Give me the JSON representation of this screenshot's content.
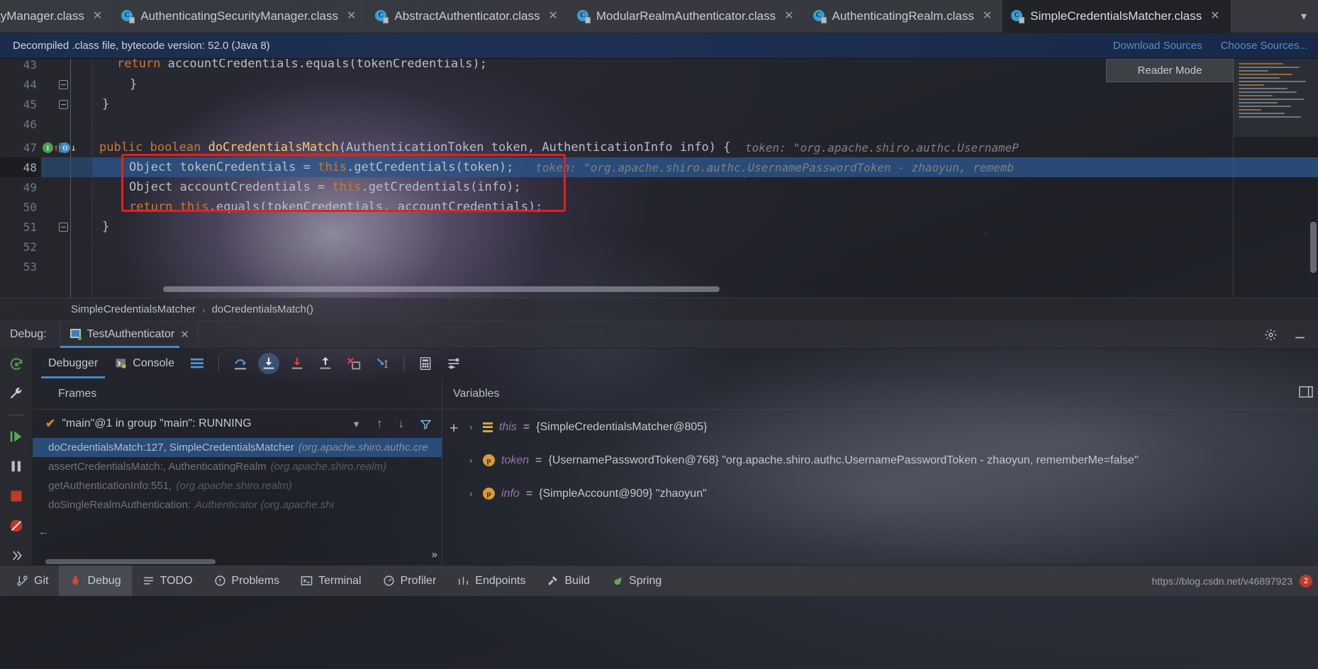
{
  "tabs": [
    {
      "label": "tyManager.class",
      "icon": "java-class-icon",
      "active": false,
      "truncated": true
    },
    {
      "label": "AuthenticatingSecurityManager.class",
      "icon": "java-class-icon",
      "active": false
    },
    {
      "label": "AbstractAuthenticator.class",
      "icon": "java-class-icon",
      "active": false
    },
    {
      "label": "ModularRealmAuthenticator.class",
      "icon": "java-class-icon",
      "active": false
    },
    {
      "label": "AuthenticatingRealm.class",
      "icon": "java-class-icon",
      "active": false
    },
    {
      "label": "SimpleCredentialsMatcher.class",
      "icon": "java-class-icon",
      "active": true
    }
  ],
  "notification": {
    "message": "Decompiled .class file, bytecode version: 52.0 (Java 8)",
    "download_sources": "Download Sources",
    "choose_sources": "Choose Sources..."
  },
  "editor": {
    "reader_mode": "Reader Mode",
    "lines": [
      {
        "num": "43",
        "partial": true
      },
      {
        "num": "44"
      },
      {
        "num": "45"
      },
      {
        "num": "46"
      },
      {
        "num": "47"
      },
      {
        "num": "48",
        "current": true
      },
      {
        "num": "49"
      },
      {
        "num": "50"
      },
      {
        "num": "51"
      },
      {
        "num": "52"
      },
      {
        "num": "53"
      }
    ],
    "code": {
      "l43_kw": "return",
      "l43_rest": " accountCredentials.equals(tokenCredentials);",
      "l44": "}",
      "l45": "}",
      "l47_mod": "public",
      "l47_type": "boolean",
      "l47_name": "doCredentialsMatch",
      "l47_params": "(AuthenticationToken token, AuthenticationInfo info) {",
      "l47_hint_key": "token:",
      "l47_hint_val": "\"org.apache.shiro.authc.UsernameP",
      "l48_type": "Object",
      "l48_var": " tokenCredentials = ",
      "l48_this": "this",
      "l48_rest": ".getCredentials(token);",
      "l48_hint_key": "token:",
      "l48_hint_val": "\"org.apache.shiro.authc.UsernamePasswordToken - zhaoyun, rememb",
      "l49_type": "Object",
      "l49_var": " accountCredentials = ",
      "l49_this": "this",
      "l49_rest": ".getCredentials(info);",
      "l50_kw": "return",
      "l50_this": " this",
      "l50_rest": ".equals(tokenCredentials, accountCredentials);",
      "l51": "}",
      "l52": "}"
    }
  },
  "breadcrumb": {
    "class": "SimpleCredentialsMatcher",
    "separator": "›",
    "method": "doCredentialsMatch()"
  },
  "debug_header": {
    "label": "Debug:",
    "config_name": "TestAuthenticator",
    "close": "✕",
    "settings_icon": "gear-icon",
    "minimize_icon": "minimize-icon"
  },
  "debug_toolbar": {
    "tabs": [
      {
        "label": "Debugger",
        "icon": "",
        "active": true
      },
      {
        "label": "Console",
        "icon": "console-icon",
        "active": false
      }
    ],
    "buttons": [
      {
        "name": "layout-settings-button",
        "icon": "lines-icon"
      },
      {
        "name": "step-over-button",
        "icon": "step-over-icon"
      },
      {
        "name": "step-into-button",
        "icon": "step-into-icon",
        "selected": true
      },
      {
        "name": "force-step-into-button",
        "icon": "force-step-into-icon"
      },
      {
        "name": "step-out-button",
        "icon": "step-out-icon"
      },
      {
        "name": "drop-frame-button",
        "icon": "drop-frame-icon"
      },
      {
        "name": "run-to-cursor-button",
        "icon": "run-to-cursor-icon"
      },
      {
        "name": "evaluate-expression-button",
        "icon": "calculator-icon"
      },
      {
        "name": "settings-button",
        "icon": "sliders-icon"
      }
    ]
  },
  "side_rail": [
    {
      "name": "rerun-button",
      "icon": "rerun-icon",
      "color": "#4f9e53"
    },
    {
      "name": "settings-wrench-button",
      "icon": "wrench-icon",
      "color": "#c6cbd1"
    },
    {
      "name": "resume-button",
      "icon": "resume-icon",
      "color": "#5aa85e"
    },
    {
      "name": "pause-button",
      "icon": "pause-icon",
      "color": "#b9bec5"
    },
    {
      "name": "stop-button",
      "icon": "stop-icon",
      "color": "#c0392b"
    },
    {
      "name": "mute-breakpoints-button",
      "icon": "breakpoint-mute-icon",
      "color": "#c0392b"
    },
    {
      "name": "expand-rail-button",
      "icon": "chevrons-right-icon",
      "color": "#b9bec5"
    }
  ],
  "frames_panel": {
    "title": "Frames",
    "thread": "\"main\"@1 in group \"main\": RUNNING",
    "thread_dropdown_icon": "chevron-down-icon",
    "up_icon": "arrow-up-icon",
    "down_icon": "arrow-down-icon",
    "filter_icon": "filter-icon",
    "frames": [
      {
        "method": "doCredentialsMatch:127, SimpleCredentialsMatcher",
        "pkg": "(org.apache.shiro.authc.cre",
        "selected": true
      },
      {
        "method": "assertCredentialsMatch:, AuthenticatingRealm",
        "pkg": "(org.apache.shiro.realm)",
        "selected": false
      },
      {
        "method": "getAuthenticationInfo:551,",
        "pkg": "(org.apache.shiro.realm)",
        "selected": false
      },
      {
        "method": "doSingleRealmAuthentication:",
        "pkg": "Authenticator (org.apache.shi",
        "selected": false
      }
    ],
    "more_icon": "»"
  },
  "variables_panel": {
    "title": "Variables",
    "add_icon": "+",
    "rows": [
      {
        "chevron": "›",
        "icon": "this-icon",
        "name": "this",
        "eq": " = ",
        "value": "{SimpleCredentialsMatcher@805}"
      },
      {
        "chevron": "›",
        "icon": "parameter-icon",
        "name": "token",
        "eq": " = ",
        "value": "{UsernamePasswordToken@768} \"org.apache.shiro.authc.UsernamePasswordToken - zhaoyun, rememberMe=false\""
      },
      {
        "chevron": "›",
        "icon": "parameter-icon",
        "name": "info",
        "eq": " = ",
        "value": "{SimpleAccount@909} \"zhaoyun\""
      }
    ]
  },
  "statusbar": {
    "items": [
      {
        "label": "Git",
        "icon": "git-icon",
        "active": false
      },
      {
        "label": "Debug",
        "icon": "debug-icon",
        "active": true
      },
      {
        "label": "TODO",
        "icon": "todo-icon",
        "active": false
      },
      {
        "label": "Problems",
        "icon": "problems-icon",
        "active": false
      },
      {
        "label": "Terminal",
        "icon": "terminal-icon",
        "active": false
      },
      {
        "label": "Profiler",
        "icon": "profiler-icon",
        "active": false
      },
      {
        "label": "Endpoints",
        "icon": "endpoints-icon",
        "active": false
      },
      {
        "label": "Build",
        "icon": "build-icon",
        "active": false
      },
      {
        "label": "Spring",
        "icon": "spring-icon",
        "active": false
      }
    ],
    "watermark": "https://blog.csdn.net/v46897923",
    "badge": "2"
  },
  "colors": {
    "accent_blue": "#4a88c7",
    "selection_blue": "#2c568c",
    "keyword_orange": "#cc7832",
    "method_yellow": "#ffc66d",
    "highlight_red": "#f01b1b",
    "link_blue": "#4e8fd0"
  }
}
